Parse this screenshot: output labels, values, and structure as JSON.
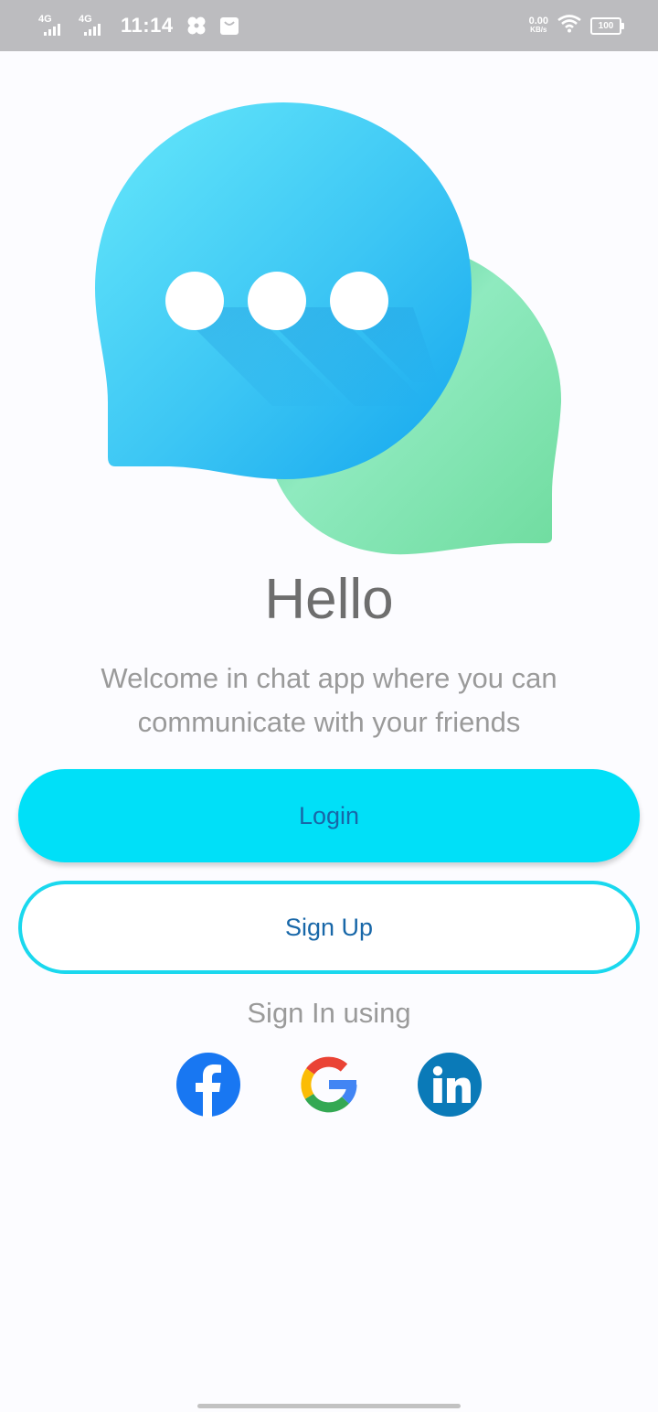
{
  "status_bar": {
    "network_1": "4G",
    "network_2": "4G",
    "time": "11:14",
    "speed_value": "0.00",
    "speed_unit": "KB/s",
    "battery": "100"
  },
  "main": {
    "title": "Hello",
    "subtitle": "Welcome in chat app where you can communicate with your friends",
    "login_label": "Login",
    "signup_label": "Sign Up",
    "signin_using_label": "Sign In using"
  },
  "social_icons": [
    "facebook-icon",
    "google-icon",
    "linkedin-icon"
  ],
  "colors": {
    "primary": "#00e0f8",
    "button_text": "#1867a8",
    "heading": "#6e6e6e",
    "muted_text": "#9a9a9a",
    "facebook": "#1877f2",
    "linkedin": "#0a7ab8",
    "bubble_blue": "#3ec8f4",
    "bubble_green": "#7ee0aa"
  }
}
